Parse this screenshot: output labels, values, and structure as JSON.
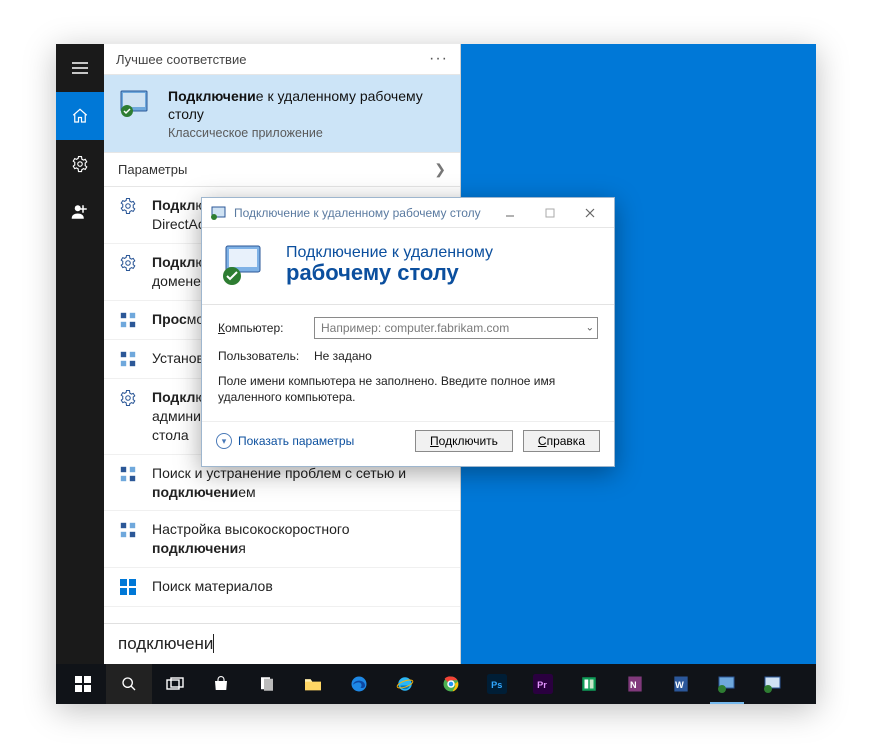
{
  "start_menu": {
    "header": "Лучшее соответствие",
    "best_match": {
      "title_prefix_bold": "Подключени",
      "title_rest": "е к удаленному рабочему столу",
      "subtitle": "Классическое приложение"
    },
    "params_header": "Параметры",
    "items": [
      {
        "kind": "gear",
        "prefix": "Подкл",
        "rest": "ючение к рабочему месту с помощью DirectAccess или VPN, настройка VPN"
      },
      {
        "kind": "gear",
        "prefix": "Подкл",
        "rest": "ючение к удаленному компьютеру в домене"
      },
      {
        "kind": "cfg",
        "prefix": "Прос",
        "rest": "мотр сети"
      },
      {
        "kind": "cfg2",
        "prefix": "",
        "rest": "Установка удаленных приложений"
      },
      {
        "kind": "gear",
        "prefix": "Подкл",
        "rest": "ючение к средствам администрирования удаленного рабочего",
        "tail_plain": " стола"
      },
      {
        "kind": "cfg",
        "prefix": "",
        "rest": "Поиск и устранение проблем с сетью и ",
        "bold_mid": "подключени",
        "tail_plain": "ем"
      },
      {
        "kind": "cfg2",
        "prefix": "",
        "rest": "Настройка высокоскоростного ",
        "bold_mid": "подключени",
        "tail_plain": "я"
      }
    ],
    "materials_label": "Поиск материалов",
    "query": "подключени"
  },
  "rdp_dialog": {
    "window_title": "Подключение к удаленному рабочему столу",
    "banner_line1": "Подключение к удаленному",
    "banner_line2": "рабочему столу",
    "computer_label": "Компьютер:",
    "computer_placeholder": "Например: computer.fabrikam.com",
    "computer_value": "",
    "user_label": "Пользователь:",
    "user_value": "Не задано",
    "note": "Поле имени компьютера не заполнено. Введите полное имя удаленного компьютера.",
    "show_params": "Показать параметры",
    "connect_btn": "Подключить",
    "help_btn": "Справка"
  },
  "taskbar": {
    "items": [
      "start",
      "search",
      "taskview",
      "store",
      "files",
      "folder",
      "edge",
      "ie",
      "chrome",
      "ps",
      "pr",
      "app1",
      "onenote",
      "word",
      "rdp-active",
      "rdp"
    ]
  }
}
